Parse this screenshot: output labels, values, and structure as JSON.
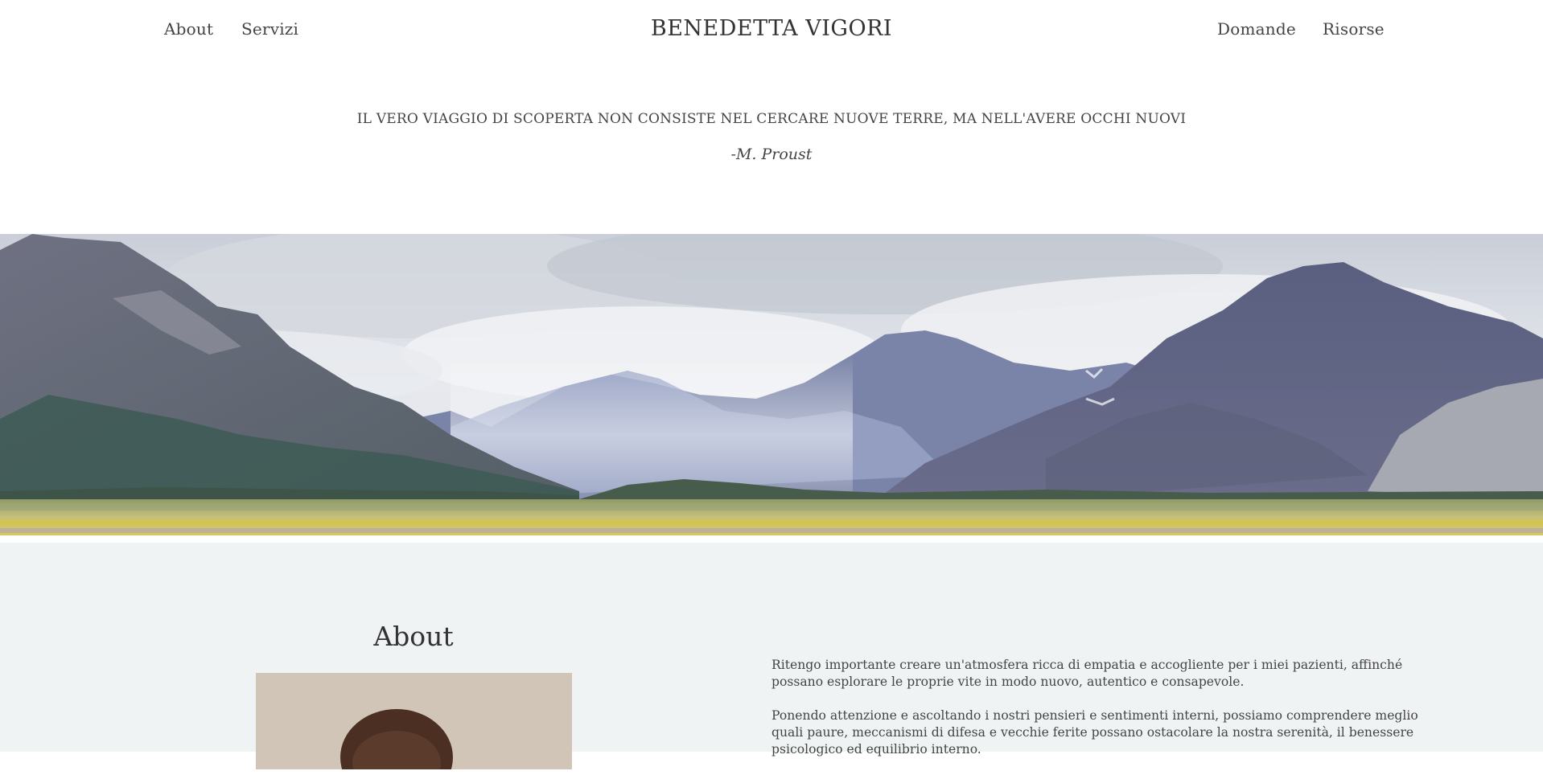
{
  "header": {
    "nav_left": [
      "About",
      "Servizi"
    ],
    "brand": "BENEDETTA VIGORI",
    "nav_right": [
      "Domande",
      "Risorse"
    ]
  },
  "quote": {
    "text": "IL VERO VIAGGIO DI SCOPERTA NON CONSISTE NEL CERCARE NUOVE TERRE, MA NELL'AVERE OCCHI NUOVI",
    "author": "-M. Proust"
  },
  "about": {
    "title": "About",
    "paragraphs": [
      "Ritengo importante creare un'atmosfera ricca di empatia e accogliente per i miei pazienti, affinché possano esplorare le proprie vite in modo nuovo, autentico e consapevole.",
      "Ponendo attenzione e ascoltando i nostri pensieri e sentimenti interni, possiamo comprendere meglio quali paure, meccanismi di difesa e vecchie ferite possano ostacolare la nostra serenità, il benessere psicologico ed equilibrio interno."
    ]
  },
  "colors": {
    "page_background": "#ffffff",
    "about_background": "#f0f3f4",
    "text": "#444444"
  },
  "icons": {
    "hero": "mountain-landscape-image",
    "portrait": "portrait-photo"
  }
}
